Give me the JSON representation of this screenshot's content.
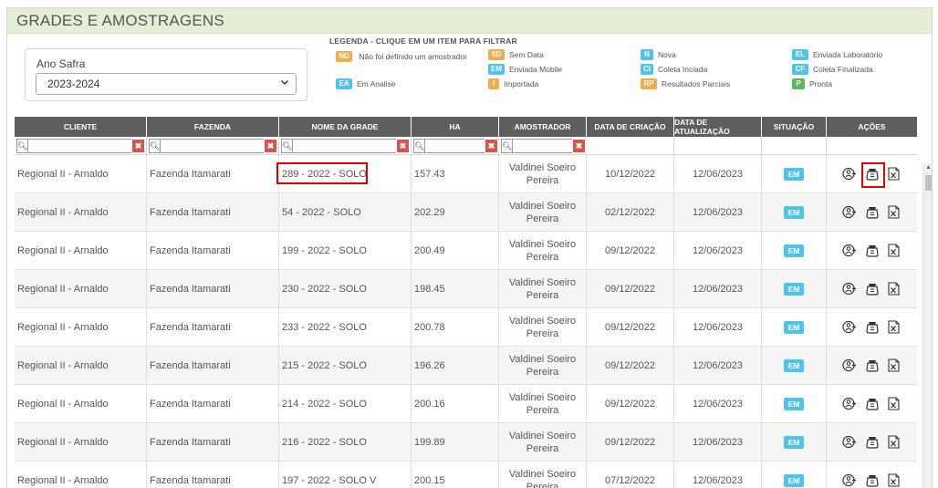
{
  "page": {
    "title": "GRADES E AMOSTRAGENS"
  },
  "safra": {
    "label": "Ano Safra",
    "value": "2023-2024"
  },
  "legend": {
    "title": "LEGENDA - CLIQUE EM UM ITEM PARA FILTRAR",
    "items": [
      {
        "code": "ND",
        "label": "Não foi definido um amostrador",
        "color": "#f0ad4e"
      },
      {
        "code": "EA",
        "label": "Em Analise",
        "color": "#4fc3e8"
      },
      {
        "code": "SD",
        "label": "Sem Data",
        "color": "#f0ad4e"
      },
      {
        "code": "EM",
        "label": "Enviada Mobile",
        "color": "#4fc3e8"
      },
      {
        "code": "I",
        "label": "Importada",
        "color": "#f0ad4e"
      },
      {
        "code": "N",
        "label": "Nova",
        "color": "#4fc3e8"
      },
      {
        "code": "CI",
        "label": "Coleta Inciada",
        "color": "#4fc3e8"
      },
      {
        "code": "RP",
        "label": "Resultados Parciais",
        "color": "#f0ad4e"
      },
      {
        "code": "EL",
        "label": "Enviada Laboratório",
        "color": "#4fc3e8"
      },
      {
        "code": "CF",
        "label": "Coleta Finalizada",
        "color": "#4fc3e8"
      },
      {
        "code": "P",
        "label": "Pronta",
        "color": "#5cb85c"
      }
    ]
  },
  "table": {
    "columns": [
      "CLIENTE",
      "FAZENDA",
      "NOME DA GRADE",
      "HA",
      "AMOSTRADOR",
      "DATA DE CRIAÇÃO",
      "DATA DE ATUALIZAÇÃO",
      "SITUAÇÃO",
      "AÇÕES"
    ],
    "rows": [
      {
        "cliente": "Regional II - Arnaldo",
        "fazenda": "Fazenda Itamarati",
        "grade": "289 - 2022 - SOLO",
        "ha": "157.43",
        "amostrador": "Valdinei Soeiro Pereira",
        "criacao": "10/12/2022",
        "atualizacao": "12/06/2023",
        "situacao": "EM"
      },
      {
        "cliente": "Regional II - Arnaldo",
        "fazenda": "Fazenda Itamarati",
        "grade": "54 - 2022 - SOLO",
        "ha": "202.29",
        "amostrador": "Valdinei Soeiro Pereira",
        "criacao": "02/12/2022",
        "atualizacao": "12/06/2023",
        "situacao": "EM"
      },
      {
        "cliente": "Regional II - Arnaldo",
        "fazenda": "Fazenda Itamarati",
        "grade": "199 - 2022 - SOLO",
        "ha": "200.49",
        "amostrador": "Valdinei Soeiro Pereira",
        "criacao": "09/12/2022",
        "atualizacao": "12/06/2023",
        "situacao": "EM"
      },
      {
        "cliente": "Regional II - Arnaldo",
        "fazenda": "Fazenda Itamarati",
        "grade": "230 - 2022 - SOLO",
        "ha": "198.45",
        "amostrador": "Valdinei Soeiro Pereira",
        "criacao": "09/12/2022",
        "atualizacao": "12/06/2023",
        "situacao": "EM"
      },
      {
        "cliente": "Regional II - Arnaldo",
        "fazenda": "Fazenda Itamarati",
        "grade": "233 - 2022 - SOLO",
        "ha": "200.78",
        "amostrador": "Valdinei Soeiro Pereira",
        "criacao": "09/12/2022",
        "atualizacao": "12/06/2023",
        "situacao": "EM"
      },
      {
        "cliente": "Regional II - Arnaldo",
        "fazenda": "Fazenda Itamarati",
        "grade": "215 - 2022 - SOLO",
        "ha": "196.26",
        "amostrador": "Valdinei Soeiro Pereira",
        "criacao": "09/12/2022",
        "atualizacao": "12/06/2023",
        "situacao": "EM"
      },
      {
        "cliente": "Regional II - Arnaldo",
        "fazenda": "Fazenda Itamarati",
        "grade": "214 - 2022 - SOLO",
        "ha": "200.16",
        "amostrador": "Valdinei Soeiro Pereira",
        "criacao": "09/12/2022",
        "atualizacao": "12/06/2023",
        "situacao": "EM"
      },
      {
        "cliente": "Regional II - Arnaldo",
        "fazenda": "Fazenda Itamarati",
        "grade": "216 - 2022 - SOLO",
        "ha": "199.89",
        "amostrador": "Valdinei Soeiro Pereira",
        "criacao": "09/12/2022",
        "atualizacao": "12/06/2023",
        "situacao": "EM"
      },
      {
        "cliente": "Regional II - Arnaldo",
        "fazenda": "Fazenda Itamarati",
        "grade": "197 - 2022 - SOLO V",
        "ha": "200.15",
        "amostrador": "Valdinei Soeiro Pereira",
        "criacao": "07/12/2022",
        "atualizacao": "12/06/2023",
        "situacao": "EM"
      }
    ],
    "actions": [
      "add-user-icon",
      "sample-bag-icon",
      "excel-export-icon"
    ],
    "status_color": "#4fc3e8",
    "highlight_color": "#e00000"
  }
}
